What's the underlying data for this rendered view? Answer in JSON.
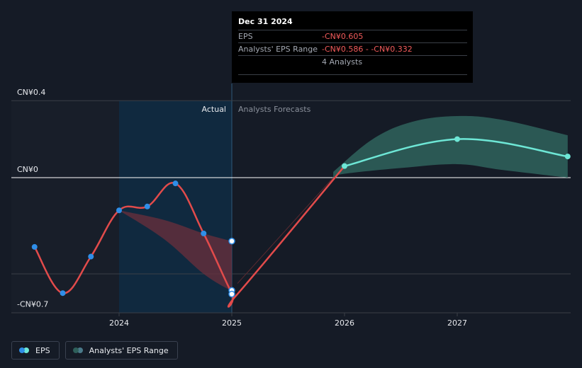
{
  "chart_data": {
    "type": "line",
    "title": "",
    "xlabel": "",
    "ylabel": "",
    "ylim": [
      -0.72,
      0.42
    ],
    "xlim": [
      2023.08,
      2027.98
    ],
    "grid": "horizontal",
    "y_ticks": [
      {
        "value": 0.4,
        "label": "CN¥0.4"
      },
      {
        "value": 0,
        "label": "CN¥0"
      },
      {
        "value": -0.7,
        "label": "-CN¥0.7"
      }
    ],
    "x_ticks": [
      {
        "value": 2024,
        "label": "2024"
      },
      {
        "value": 2025,
        "label": "2025"
      },
      {
        "value": 2026,
        "label": "2026"
      },
      {
        "value": 2027,
        "label": "2027"
      }
    ],
    "regions": {
      "actual_label": "Actual",
      "forecast_label": "Analysts Forecasts",
      "divider": 2025
    },
    "series": [
      {
        "name": "EPS",
        "color": "#e24b4b",
        "points": [
          {
            "x": 2023.25,
            "y": -0.36
          },
          {
            "x": 2023.5,
            "y": -0.6
          },
          {
            "x": 2023.75,
            "y": -0.41
          },
          {
            "x": 2024.0,
            "y": -0.17
          },
          {
            "x": 2024.25,
            "y": -0.15
          },
          {
            "x": 2024.5,
            "y": -0.03
          },
          {
            "x": 2024.75,
            "y": -0.29
          },
          {
            "x": 2025.0,
            "y": -0.6
          },
          {
            "x": 2025.05,
            "y": -0.605
          },
          {
            "x": 2026.0,
            "y": 0.06
          },
          {
            "x": 2027.0,
            "y": 0.2
          },
          {
            "x": 2027.98,
            "y": 0.11
          }
        ]
      }
    ],
    "eps_marked_points": [
      {
        "x": 2023.25,
        "y": -0.36
      },
      {
        "x": 2023.5,
        "y": -0.6
      },
      {
        "x": 2023.75,
        "y": -0.41
      },
      {
        "x": 2024.0,
        "y": -0.17
      },
      {
        "x": 2024.25,
        "y": -0.15
      },
      {
        "x": 2024.5,
        "y": -0.03
      },
      {
        "x": 2024.75,
        "y": -0.29
      },
      {
        "x": 2025.0,
        "y": -0.33
      },
      {
        "x": 2025.0,
        "y": -0.586
      },
      {
        "x": 2025.0,
        "y": -0.605
      }
    ],
    "forecast_points": [
      {
        "x": 2026.0,
        "y": 0.06
      },
      {
        "x": 2027.0,
        "y": 0.2
      },
      {
        "x": 2027.98,
        "y": 0.11
      }
    ],
    "analyst_range": {
      "name": "Analysts' EPS Range",
      "upper": [
        {
          "x": 2025.9,
          "y": 0.03
        },
        {
          "x": 2026.25,
          "y": 0.2
        },
        {
          "x": 2026.6,
          "y": 0.29
        },
        {
          "x": 2027.0,
          "y": 0.32
        },
        {
          "x": 2027.4,
          "y": 0.3
        },
        {
          "x": 2027.98,
          "y": 0.22
        }
      ],
      "lower": [
        {
          "x": 2027.98,
          "y": -0.0
        },
        {
          "x": 2027.4,
          "y": 0.04
        },
        {
          "x": 2027.0,
          "y": 0.07
        },
        {
          "x": 2026.5,
          "y": 0.05
        },
        {
          "x": 2026.0,
          "y": 0.02
        },
        {
          "x": 2025.9,
          "y": 0.0
        }
      ]
    },
    "past_range": {
      "upper": [
        {
          "x": 2024.0,
          "y": -0.17
        },
        {
          "x": 2024.4,
          "y": -0.22
        },
        {
          "x": 2024.75,
          "y": -0.29
        },
        {
          "x": 2025.0,
          "y": -0.33
        }
      ],
      "lower": [
        {
          "x": 2025.0,
          "y": -0.59
        },
        {
          "x": 2024.75,
          "y": -0.5
        },
        {
          "x": 2024.4,
          "y": -0.32
        },
        {
          "x": 2024.0,
          "y": -0.17
        }
      ]
    },
    "colors": {
      "eps": "#e24b4b",
      "eps_dot": "#2f8ee8",
      "forecast_line": "#6ee7d6",
      "range_fill": "#2e5f5a",
      "past_range_fill": "#6b2f3c",
      "grid": "#3a3f47",
      "zero_line": "#ffffff"
    }
  },
  "tooltip": {
    "date": "Dec 31 2024",
    "rows": [
      {
        "key": "EPS",
        "value": "-CN¥0.605"
      },
      {
        "key": "Analysts' EPS Range",
        "value": "-CN¥0.586 - -CN¥0.332"
      },
      {
        "key": "",
        "value": "4 Analysts"
      }
    ]
  },
  "legend": {
    "eps_label": "EPS",
    "range_label": "Analysts' EPS Range",
    "eps_colors": [
      "#2f8ee8",
      "#6ee7d6"
    ],
    "range_colors": [
      "#2e5f5a",
      "#4a7a8a"
    ]
  }
}
